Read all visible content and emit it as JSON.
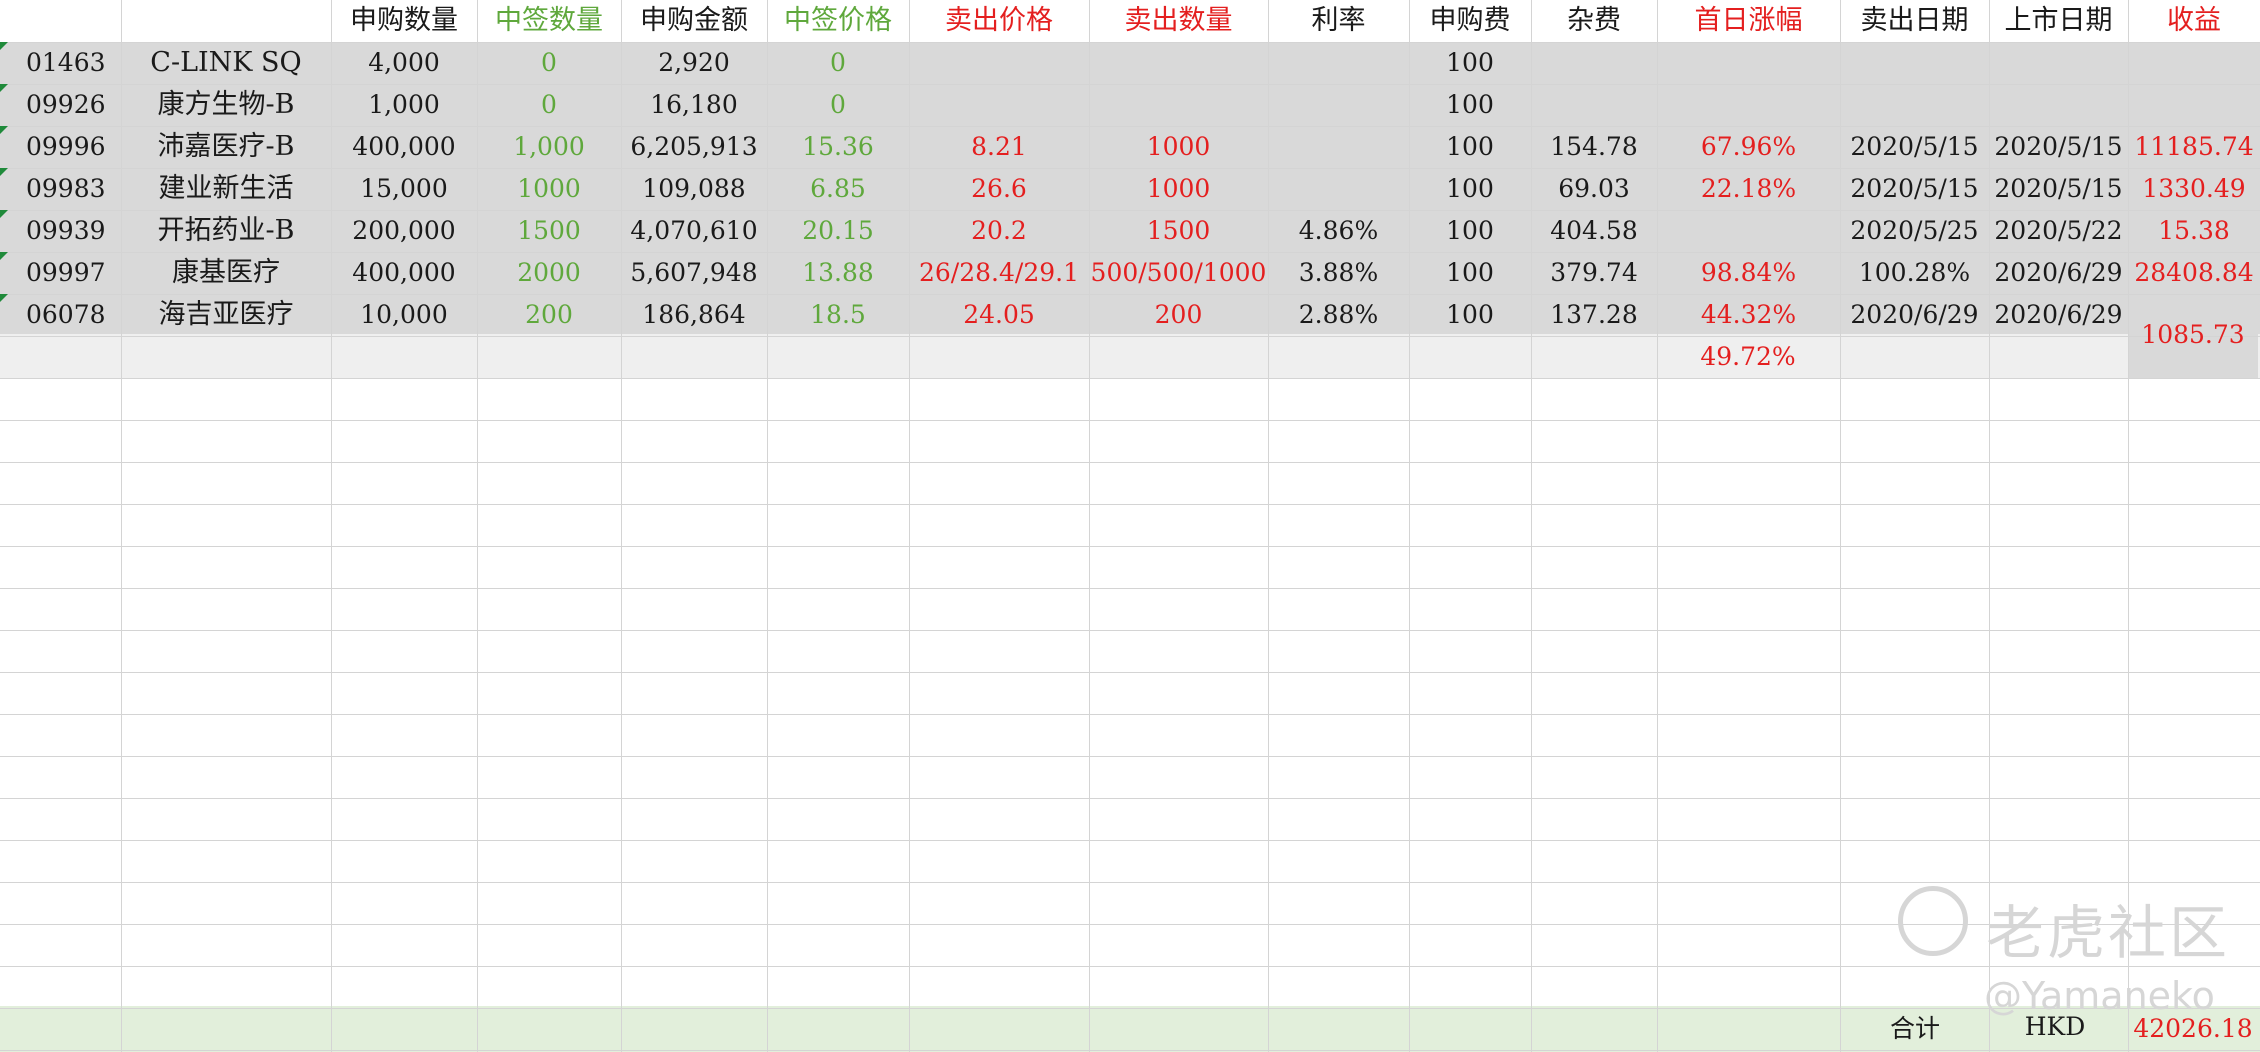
{
  "headers": [
    "",
    "",
    "申购数量",
    "中签数量",
    "申购金额",
    "中签价格",
    "卖出价格",
    "卖出数量",
    "利率",
    "申购费",
    "杂费",
    "首日涨幅",
    "卖出日期",
    "上市日期",
    "收益"
  ],
  "header_colors": [
    "#1a1a1a",
    "#1a1a1a",
    "#1a1a1a",
    "#5fa83c",
    "#1a1a1a",
    "#5fa83c",
    "#e41f1f",
    "#e41f1f",
    "#1a1a1a",
    "#1a1a1a",
    "#1a1a1a",
    "#e41f1f",
    "#1a1a1a",
    "#1a1a1a",
    "#e41f1f"
  ],
  "rows": [
    [
      "01463",
      "C-LINK SQ",
      "4,000",
      "0",
      "2,920",
      "0",
      "",
      "",
      "",
      "100",
      "",
      "",
      "",
      "",
      ""
    ],
    [
      "09926",
      "康方生物-B",
      "1,000",
      "0",
      "16,180",
      "0",
      "",
      "",
      "",
      "100",
      "",
      "",
      "",
      "",
      ""
    ],
    [
      "09996",
      "沛嘉医疗-B",
      "400,000",
      "1,000",
      "6,205,913",
      "15.36",
      "8.21",
      "1000",
      "",
      "100",
      "154.78",
      "67.96%",
      "2020/5/15",
      "2020/5/15",
      "11185.74"
    ],
    [
      "09983",
      "建业新生活",
      "15,000",
      "1000",
      "109,088",
      "6.85",
      "26.6",
      "1000",
      "",
      "100",
      "69.03",
      "22.18%",
      "2020/5/15",
      "2020/5/15",
      "1330.49"
    ],
    [
      "09939",
      "开拓药业-B",
      "200,000",
      "1500",
      "4,070,610",
      "20.15",
      "20.2",
      "1500",
      "4.86%",
      "100",
      "404.58",
      "",
      "2020/5/25",
      "2020/5/22",
      "15.38"
    ],
    [
      "09997",
      "康基医疗",
      "400,000",
      "2000",
      "5,607,948",
      "13.88",
      "26/28.4/29.1",
      "500/500/1000",
      "3.88%",
      "100",
      "379.74",
      "98.84%",
      "100.28%",
      "2020/6/29",
      "28408.84"
    ],
    [
      "06078",
      "海吉亚医疗",
      "10,000",
      "200",
      "186,864",
      "18.5",
      "24.05",
      "200",
      "2.88%",
      "100",
      "137.28",
      "44.32%",
      "2020/6/29",
      "2020/6/29",
      ""
    ]
  ],
  "summary": {
    "avg_rise": "49.72%",
    "last_profit": "1085.73"
  },
  "total": {
    "label": "合计",
    "currency": "HKD",
    "value": "42026.18"
  },
  "watermark": {
    "brand": "老虎社区",
    "user": "@Yamaneko"
  },
  "colors": {
    "gray_band": "#d9d9d9",
    "light_gray_band": "#efefef",
    "total_band": "#e2efdb",
    "green": "#5fa83c",
    "red": "#e41f1f"
  }
}
